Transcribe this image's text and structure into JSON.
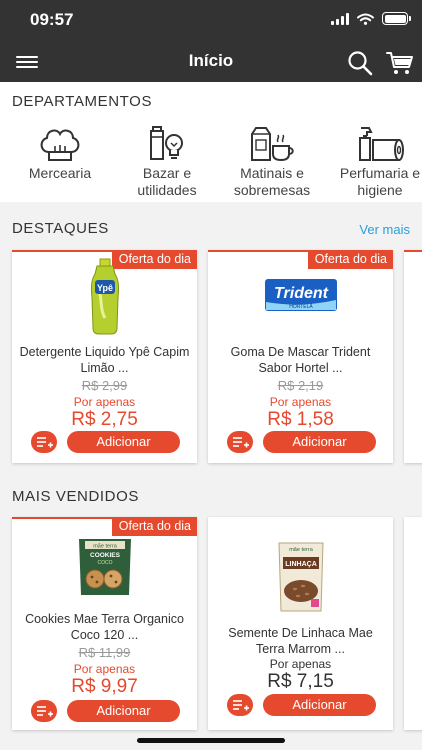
{
  "status_bar": {
    "time": "09:57"
  },
  "nav": {
    "title": "Início",
    "menu_icon": "menu-icon",
    "search_icon": "search-icon",
    "cart_icon": "cart-icon"
  },
  "departments": {
    "title": "DEPARTAMENTOS",
    "items": [
      {
        "label": "Mercearia",
        "icon": "chef-hat-icon"
      },
      {
        "label": "Bazar e utilidades",
        "icon": "thermos-lightbulb-icon"
      },
      {
        "label": "Matinais e sobremesas",
        "icon": "milk-coffee-icon"
      },
      {
        "label": "Perfumaria e higiene",
        "icon": "spray-toilet-paper-icon"
      }
    ]
  },
  "highlights": {
    "title": "DESTAQUES",
    "see_more": "Ver mais",
    "products": [
      {
        "badge": "Oferta do dia",
        "name": "Detergente Liquido Ypê Capim Limão ...",
        "old_price": "R$ 2,99",
        "por_apenas": "Por apenas",
        "price": "R$ 2,75",
        "add_label": "Adicionar"
      },
      {
        "badge": "Oferta do dia",
        "name": "Goma De Mascar Trident Sabor Hortel ...",
        "old_price": "R$ 2,19",
        "por_apenas": "Por apenas",
        "price": "R$ 1,58",
        "add_label": "Adicionar"
      }
    ]
  },
  "best_sellers": {
    "title": "MAIS VENDIDOS",
    "products": [
      {
        "badge": "Oferta do dia",
        "name": "Cookies Mae Terra Organico Coco 120 ...",
        "old_price": "R$ 11,99",
        "por_apenas": "Por apenas",
        "price": "R$ 9,97",
        "add_label": "Adicionar"
      },
      {
        "name": "Semente De Linhaca Mae Terra Marrom ...",
        "por_apenas": "Por apenas",
        "price": "R$ 7,15",
        "add_label": "Adicionar"
      }
    ]
  },
  "product_images": {
    "ype_bottle": {
      "brand": "Ypê"
    },
    "trident_pack": {
      "brand": "Trident",
      "sub": "HORTELÃ"
    },
    "cookies_bag": {
      "brand": "mãe terra",
      "line1": "COOKIES",
      "line2": "COCO"
    },
    "linhaca_bag": {
      "brand": "mãe terra",
      "line1": "LINHAÇA"
    }
  },
  "colors": {
    "accent": "#e64a2e",
    "bar": "#333333",
    "link": "#2a9fd6"
  }
}
